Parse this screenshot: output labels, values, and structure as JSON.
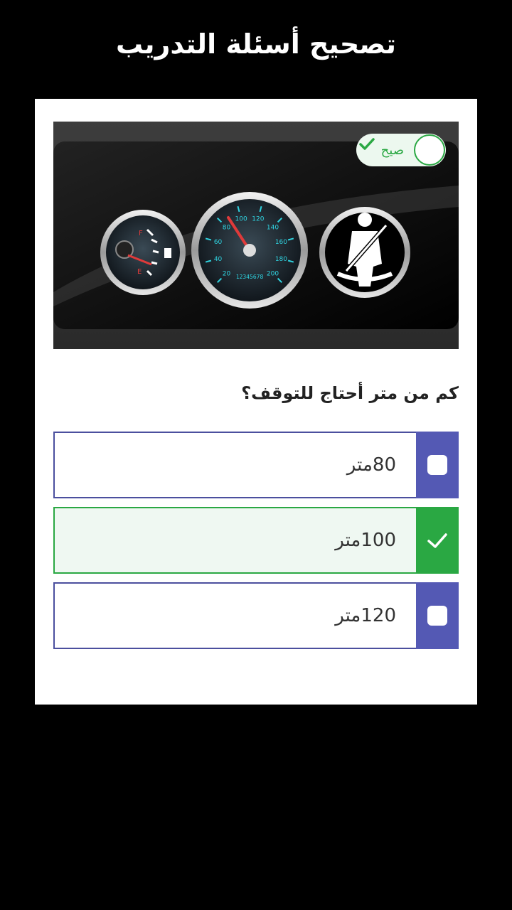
{
  "header": {
    "title": "تصحيح أسئلة التدريب"
  },
  "result_badge": {
    "label": "صيح",
    "icon": "checkmark-circle-icon",
    "color": "#2aa843"
  },
  "dashboard_image": {
    "speedometer_ticks": [
      "20",
      "40",
      "60",
      "80",
      "100",
      "120",
      "140",
      "160",
      "180",
      "200"
    ],
    "odometer": "12345678",
    "fuel_full": "F",
    "fuel_empty": "E"
  },
  "question": {
    "text": "كم من متر أحتاج للتوقف؟"
  },
  "options": [
    {
      "label": "80متر",
      "state": "unchecked"
    },
    {
      "label": "100متر",
      "state": "correct"
    },
    {
      "label": "120متر",
      "state": "unchecked"
    }
  ],
  "colors": {
    "accent": "#5459b4",
    "correct": "#2aa843"
  }
}
